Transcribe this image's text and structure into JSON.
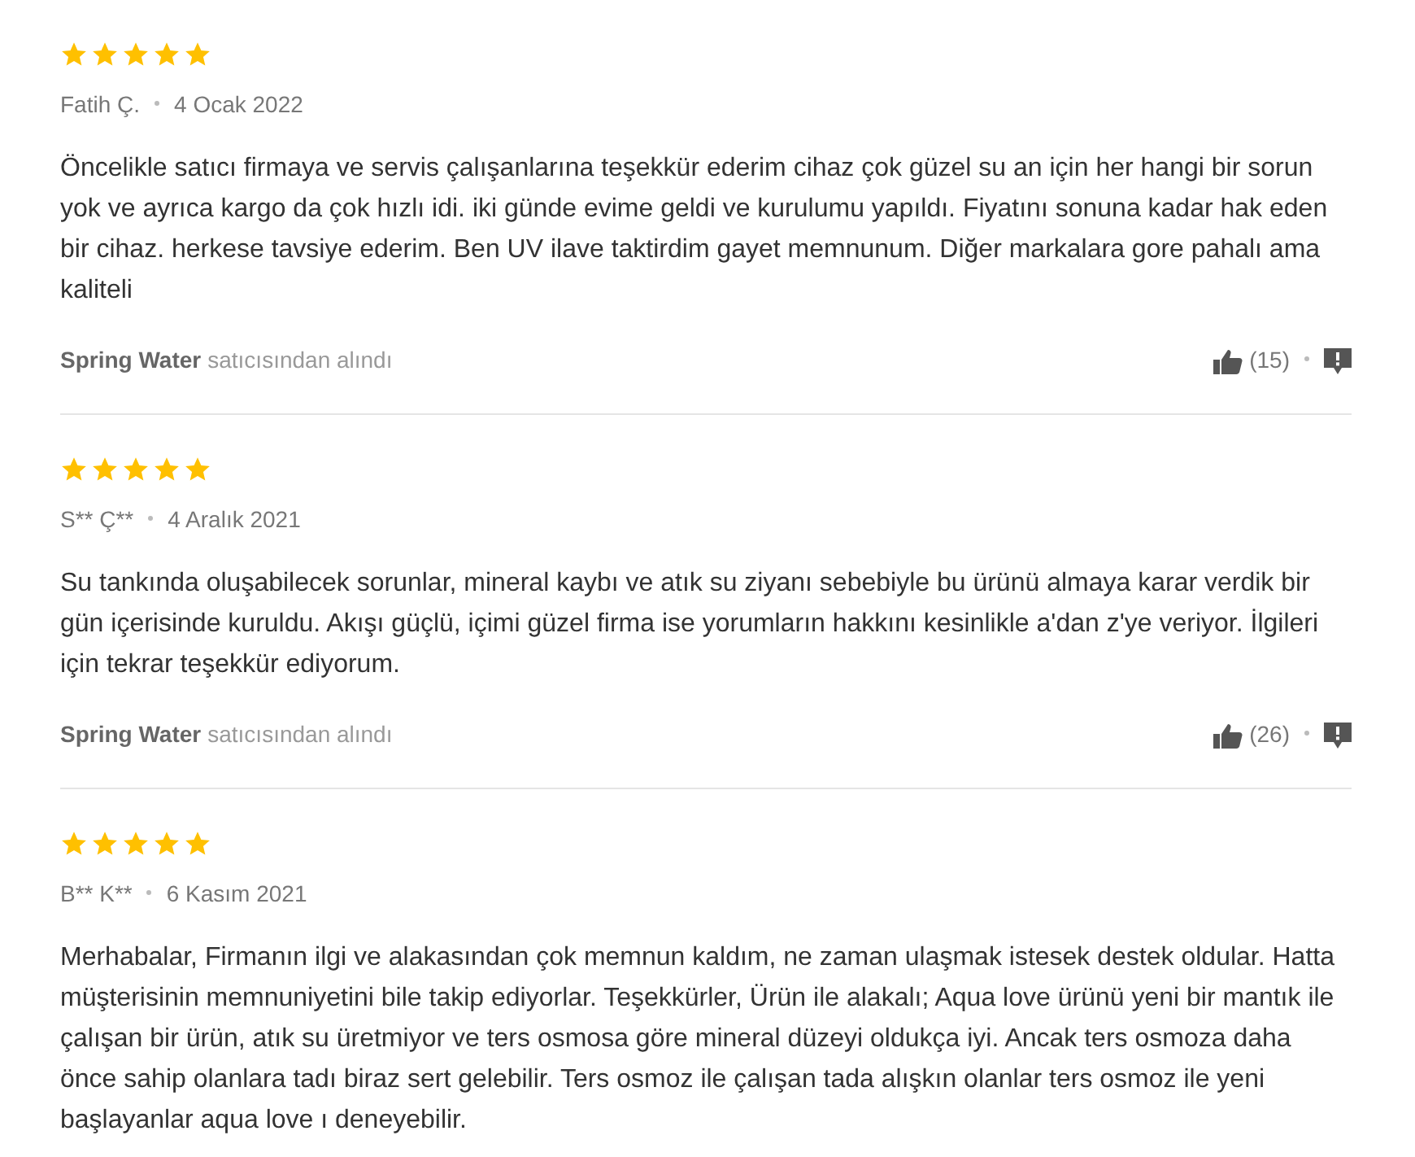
{
  "reviews": [
    {
      "stars": 5,
      "author": "Fatih Ç.",
      "date": "4 Ocak 2022",
      "text": "Öncelikle satıcı firmaya ve servis çalışanlarına teşekkür ederim cihaz çok güzel su an için her hangi bir sorun yok ve ayrıca kargo da çok hızlı idi. iki günde evime geldi ve kurulumu yapıldı. Fiyatını sonuna kadar hak eden bir cihaz. herkese tavsiye ederim. Ben UV ilave taktirdim gayet memnunum. Diğer markalara gore pahalı ama kaliteli",
      "seller": "Spring Water",
      "seller_suffix": "satıcısından alındı",
      "likes": "(15)"
    },
    {
      "stars": 5,
      "author": "S** Ç**",
      "date": "4 Aralık 2021",
      "text": "Su tankında oluşabilecek sorunlar, mineral kaybı ve atık su ziyanı sebebiyle bu ürünü almaya karar verdik bir gün içerisinde kuruldu. Akışı güçlü, içimi güzel firma ise yorumların hakkını kesinlikle a'dan z'ye veriyor. İlgileri için tekrar teşekkür ediyorum.",
      "seller": "Spring Water",
      "seller_suffix": "satıcısından alındı",
      "likes": "(26)"
    },
    {
      "stars": 5,
      "author": "B** K**",
      "date": "6 Kasım 2021",
      "text": "Merhabalar, Firmanın ilgi ve alakasından çok memnun kaldım, ne zaman ulaşmak istesek destek oldular. Hatta müşterisinin memnuniyetini bile takip ediyorlar. Teşekkürler, Ürün ile alakalı; Aqua love ürünü yeni bir mantık ile çalışan bir ürün, atık su üretmiyor ve ters osmosa göre mineral düzeyi oldukça iyi. Ancak ters osmoza daha önce sahip olanlara tadı biraz sert gelebilir. Ters osmoz ile çalışan tada alışkın olanlar ters osmoz ile yeni başlayanlar aqua love ı deneyebilir."
    }
  ]
}
